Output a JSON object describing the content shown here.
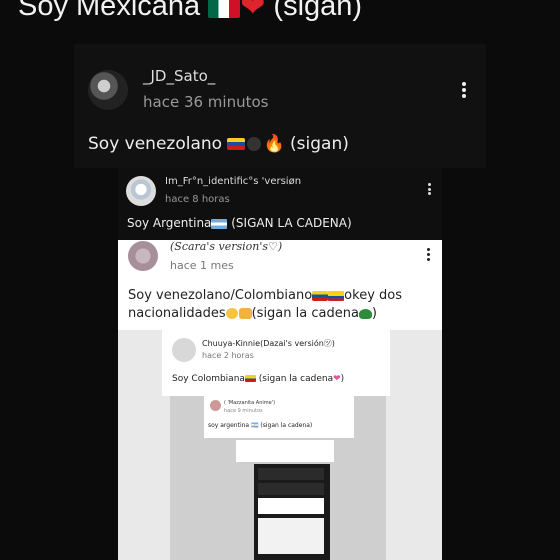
{
  "header": {
    "text_before": "Soy Mexicana",
    "text_after": "(sigan)"
  },
  "post1": {
    "username": "_JD_Sato_",
    "time": "hace 36 minutos",
    "text_before": "Soy venezolano",
    "text_after": "(sigan)"
  },
  "post2": {
    "username": "Im_Fr°n_identific°s 'versiøn",
    "time": "hace 8 horas",
    "text_before": "Soy Argentina",
    "text_after": "(SIGAN LA CADENA)"
  },
  "post3": {
    "username": "(Scara's version's♡)",
    "time": "hace 1 mes",
    "line1": "Soy venezolano/Colombiano",
    "line1_after": "okey dos",
    "line2": "nacionalidades",
    "line2_after": "(sigan la cadena",
    "line2_end": ")"
  },
  "post4": {
    "username": "Chuuya-Kinnie(Dazai's versión㋡)",
    "time": "hace 2 horas",
    "text_before": "Soy Colombiana",
    "text_after": "(sigan la cadena",
    "text_end": ")"
  },
  "post5": {
    "username": "( 'Mazzanita Anime')",
    "time": "hace 9 minutos",
    "text": "soy argentina 🇦🇷 (sigan la cadena)"
  },
  "icons": {
    "more": "more-vertical-icon"
  },
  "colors": {
    "dark_bg": "#0b0b0b",
    "card_dark": "#111111",
    "card_light": "#ffffff",
    "nested_bg": "#e9e9e9"
  }
}
